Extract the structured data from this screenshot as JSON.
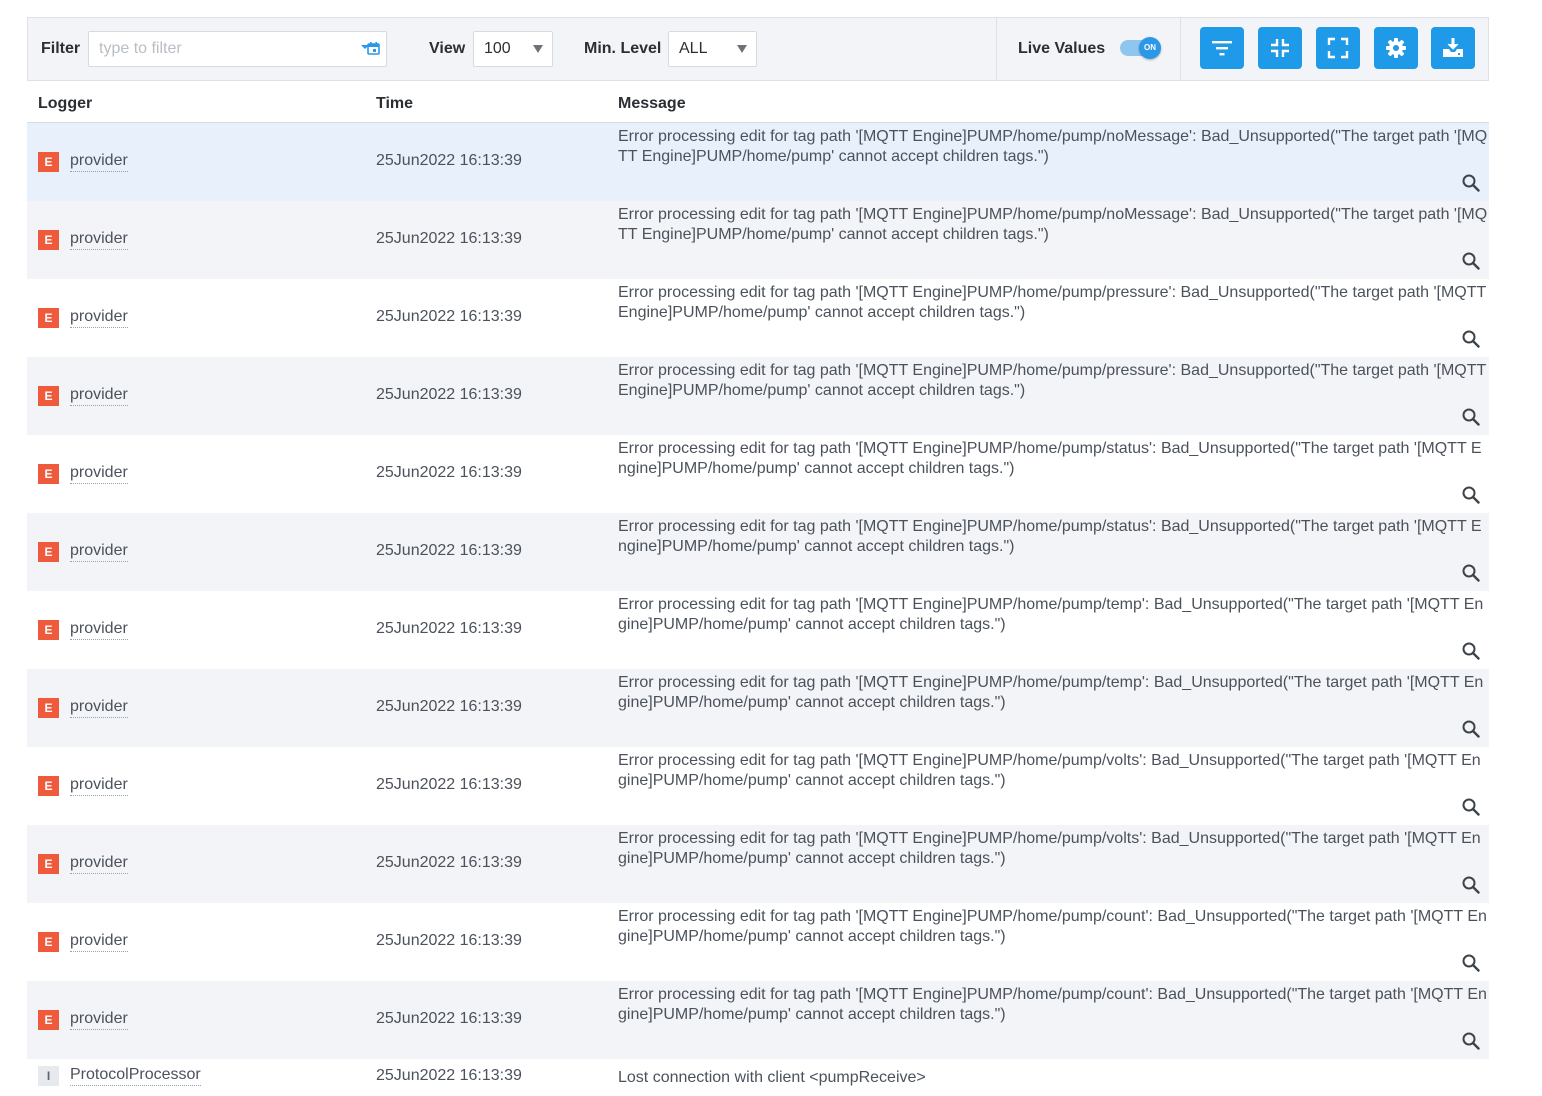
{
  "toolbar": {
    "filter_label": "Filter",
    "filter_placeholder": "type to filter",
    "filter_value": "",
    "view_label": "View",
    "view_value": "100",
    "min_level_label": "Min. Level",
    "min_level_value": "ALL",
    "live_values_label": "Live Values",
    "live_values_state": "ON",
    "accent_color": "#1f9ae8",
    "buttons": [
      "filter-icon",
      "collapse-icon",
      "expand-icon",
      "gear-icon",
      "download-icon"
    ]
  },
  "table": {
    "columns": [
      "Logger",
      "Time",
      "Message"
    ],
    "rows": [
      {
        "level": "E",
        "logger": "provider",
        "time": "25Jun2022 16:13:39",
        "message": "Error processing edit for tag path '[MQTT Engine]PUMP/home/pump/noMessage': Bad_Unsupported(\"The target path '[MQTT Engine]PUMP/home/pump' cannot accept children tags.\")"
      },
      {
        "level": "E",
        "logger": "provider",
        "time": "25Jun2022 16:13:39",
        "message": "Error processing edit for tag path '[MQTT Engine]PUMP/home/pump/noMessage': Bad_Unsupported(\"The target path '[MQTT Engine]PUMP/home/pump' cannot accept children tags.\")"
      },
      {
        "level": "E",
        "logger": "provider",
        "time": "25Jun2022 16:13:39",
        "message": "Error processing edit for tag path '[MQTT Engine]PUMP/home/pump/pressure': Bad_Unsupported(\"The target path '[MQTT Engine]PUMP/home/pump' cannot accept children tags.\")"
      },
      {
        "level": "E",
        "logger": "provider",
        "time": "25Jun2022 16:13:39",
        "message": "Error processing edit for tag path '[MQTT Engine]PUMP/home/pump/pressure': Bad_Unsupported(\"The target path '[MQTT Engine]PUMP/home/pump' cannot accept children tags.\")"
      },
      {
        "level": "E",
        "logger": "provider",
        "time": "25Jun2022 16:13:39",
        "message": "Error processing edit for tag path '[MQTT Engine]PUMP/home/pump/status': Bad_Unsupported(\"The target path '[MQTT Engine]PUMP/home/pump' cannot accept children tags.\")"
      },
      {
        "level": "E",
        "logger": "provider",
        "time": "25Jun2022 16:13:39",
        "message": "Error processing edit for tag path '[MQTT Engine]PUMP/home/pump/status': Bad_Unsupported(\"The target path '[MQTT Engine]PUMP/home/pump' cannot accept children tags.\")"
      },
      {
        "level": "E",
        "logger": "provider",
        "time": "25Jun2022 16:13:39",
        "message": "Error processing edit for tag path '[MQTT Engine]PUMP/home/pump/temp': Bad_Unsupported(\"The target path '[MQTT Engine]PUMP/home/pump' cannot accept children tags.\")"
      },
      {
        "level": "E",
        "logger": "provider",
        "time": "25Jun2022 16:13:39",
        "message": "Error processing edit for tag path '[MQTT Engine]PUMP/home/pump/temp': Bad_Unsupported(\"The target path '[MQTT Engine]PUMP/home/pump' cannot accept children tags.\")"
      },
      {
        "level": "E",
        "logger": "provider",
        "time": "25Jun2022 16:13:39",
        "message": "Error processing edit for tag path '[MQTT Engine]PUMP/home/pump/volts': Bad_Unsupported(\"The target path '[MQTT Engine]PUMP/home/pump' cannot accept children tags.\")"
      },
      {
        "level": "E",
        "logger": "provider",
        "time": "25Jun2022 16:13:39",
        "message": "Error processing edit for tag path '[MQTT Engine]PUMP/home/pump/volts': Bad_Unsupported(\"The target path '[MQTT Engine]PUMP/home/pump' cannot accept children tags.\")"
      },
      {
        "level": "E",
        "logger": "provider",
        "time": "25Jun2022 16:13:39",
        "message": "Error processing edit for tag path '[MQTT Engine]PUMP/home/pump/count': Bad_Unsupported(\"The target path '[MQTT Engine]PUMP/home/pump' cannot accept children tags.\")"
      },
      {
        "level": "E",
        "logger": "provider",
        "time": "25Jun2022 16:13:39",
        "message": "Error processing edit for tag path '[MQTT Engine]PUMP/home/pump/count': Bad_Unsupported(\"The target path '[MQTT Engine]PUMP/home/pump' cannot accept children tags.\")"
      },
      {
        "level": "I",
        "logger": "ProtocolProcessor",
        "time": "25Jun2022 16:13:39",
        "message": "Lost connection with client <pumpReceive>"
      }
    ]
  },
  "colors": {
    "error_badge": "#ee5a3b",
    "info_badge": "#e6e9ed",
    "alt_row": "#f2f4f7",
    "selected_row": "#e8f1fb"
  }
}
